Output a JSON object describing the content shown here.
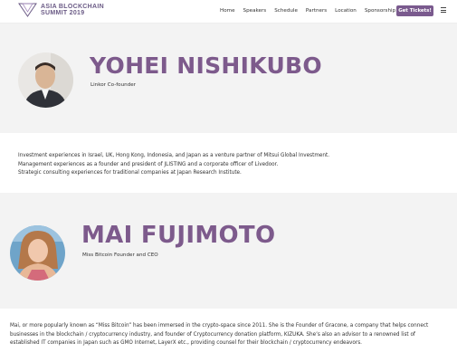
{
  "header": {
    "logo_line1": "ASIA BLOCKCHAIN",
    "logo_line2": "SUMMIT 2019",
    "nav": [
      "Home",
      "Speakers",
      "Schedule",
      "Partners",
      "Location",
      "Sponsorship"
    ],
    "cta": "Get Tickets!",
    "menu_icon": "hamburger-icon"
  },
  "speakers": [
    {
      "name": "YOHEI NISHIKUBO",
      "role": "Linkor Co-founder",
      "bio": [
        "Investment experiences in Israel, UK, Hong Kong, Indonesia, and Japan as a venture partner of Mitsui Global Investment.",
        "Management experiences as a founder and president of JLISTING and a corporate officer of Livedoor.",
        "Strategic consulting experiences for traditional companies at Japan Research Institute."
      ]
    },
    {
      "name": "MAI FUJIMOTO",
      "role": "Miss Bitcoin Founder and CEO",
      "bio": [
        "Mai, or more popularly known as “Miss Bitcoin” has been immersed in the crypto-space since 2011. She is the Founder of Gracone, a company that helps connect",
        "businesses in the blockchain / cryptocurrency industry, and founder of Cryptocurrency donation platform, KIZUKA. She’s also an advisor to a renowned list of",
        "established IT companies in Japan such as GMO Internet, LayerX etc., providing counsel for their blockchain / cryptocurrency endeavors."
      ]
    }
  ],
  "colors": {
    "accent": "#7d5a8c",
    "button": "#7a5a8e"
  }
}
